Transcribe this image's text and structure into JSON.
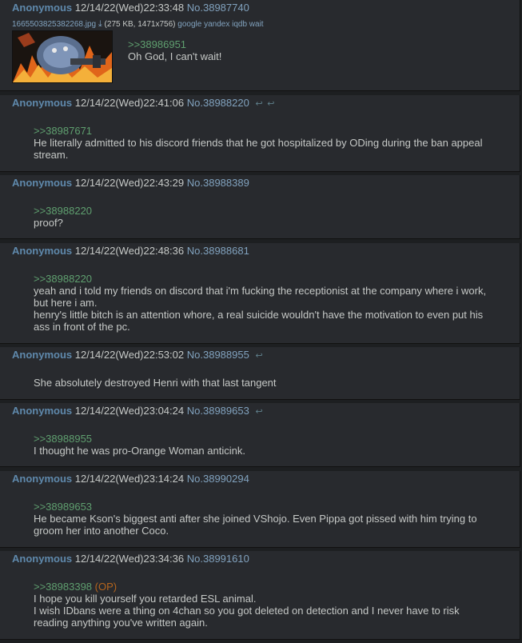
{
  "posts": [
    {
      "name": "Anonymous",
      "datetime": "12/14/22(Wed)22:33:48",
      "no": "No.38987740",
      "file": {
        "filename": "1665503825382268.jpg",
        "meta": "(275 KB, 1471x756)",
        "links": "google yandex iqdb wait"
      },
      "quote": ">>38986951",
      "lines": [
        "Oh God, I can't wait!"
      ]
    },
    {
      "name": "Anonymous",
      "datetime": "12/14/22(Wed)22:41:06",
      "no": "No.38988220",
      "backlinks": 2,
      "quote": ">>38987671",
      "lines": [
        "He literally admitted to his discord friends that he got hospitalized by ODing during the ban appeal",
        "stream."
      ]
    },
    {
      "name": "Anonymous",
      "datetime": "12/14/22(Wed)22:43:29",
      "no": "No.38988389",
      "quote": ">>38988220",
      "lines": [
        "proof?"
      ]
    },
    {
      "name": "Anonymous",
      "datetime": "12/14/22(Wed)22:48:36",
      "no": "No.38988681",
      "quote": ">>38988220",
      "lines": [
        "yeah and i told my friends on discord that i'm fucking the receptionist at the company where i work,",
        "but here i am.",
        "henry's little bitch is an attention whore, a real suicide wouldn't have the motivation to even put his",
        "ass in front of the pc."
      ]
    },
    {
      "name": "Anonymous",
      "datetime": "12/14/22(Wed)22:53:02",
      "no": "No.38988955",
      "backlinks": 1,
      "quote": "",
      "lines": [
        "She absolutely destroyed Henri with that last tangent"
      ]
    },
    {
      "name": "Anonymous",
      "datetime": "12/14/22(Wed)23:04:24",
      "no": "No.38989653",
      "backlinks": 1,
      "quote": ">>38988955",
      "lines": [
        "I thought he was pro-Orange Woman anticink."
      ]
    },
    {
      "name": "Anonymous",
      "datetime": "12/14/22(Wed)23:14:24",
      "no": "No.38990294",
      "quote": ">>38989653",
      "lines": [
        "He became Kson's biggest anti after she joined VShojo. Even Pippa got pissed with him trying to",
        "groom her into another Coco."
      ]
    },
    {
      "name": "Anonymous",
      "datetime": "12/14/22(Wed)23:34:36",
      "no": "No.38991610",
      "quote": ">>38983398",
      "op_tag": "(OP)",
      "lines": [
        "I hope you kill yourself you retarded ESL animal.",
        "I wish IDbans were a thing on 4chan so you got deleted on detection and I never have to risk",
        "reading anything you've written again."
      ]
    }
  ]
}
